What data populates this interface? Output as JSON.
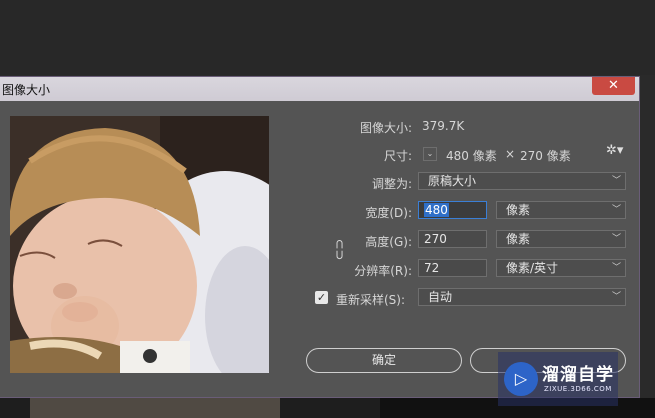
{
  "window": {
    "title": "图像大小",
    "close_glyph": "✕"
  },
  "info": {
    "image_size_label": "图像大小:",
    "image_size_value": "379.7K",
    "dimensions_label": "尺寸:",
    "width_px": "480 像素",
    "times": "×",
    "height_px": "270 像素"
  },
  "fit_to": {
    "label": "调整为:",
    "value": "原稿大小"
  },
  "width": {
    "label": "宽度(D):",
    "value": "480",
    "unit": "像素"
  },
  "height": {
    "label": "高度(G):",
    "value": "270",
    "unit": "像素"
  },
  "resolution": {
    "label": "分辨率(R):",
    "value": "72",
    "unit": "像素/英寸"
  },
  "resample": {
    "checked": true,
    "label": "重新采样(S):",
    "value": "自动"
  },
  "buttons": {
    "ok": "确定",
    "cancel": ""
  },
  "watermark": {
    "logo_glyph": "▷",
    "title": "溜溜自学",
    "subtitle": "ZIXUE.3D66.COM"
  },
  "icons": {
    "gear": "gear-icon",
    "link": "chain-link-icon",
    "chevron": "chevron-down-icon"
  },
  "colors": {
    "accent": "#2f6fc8",
    "close": "#c94a42",
    "panel": "#545454"
  }
}
